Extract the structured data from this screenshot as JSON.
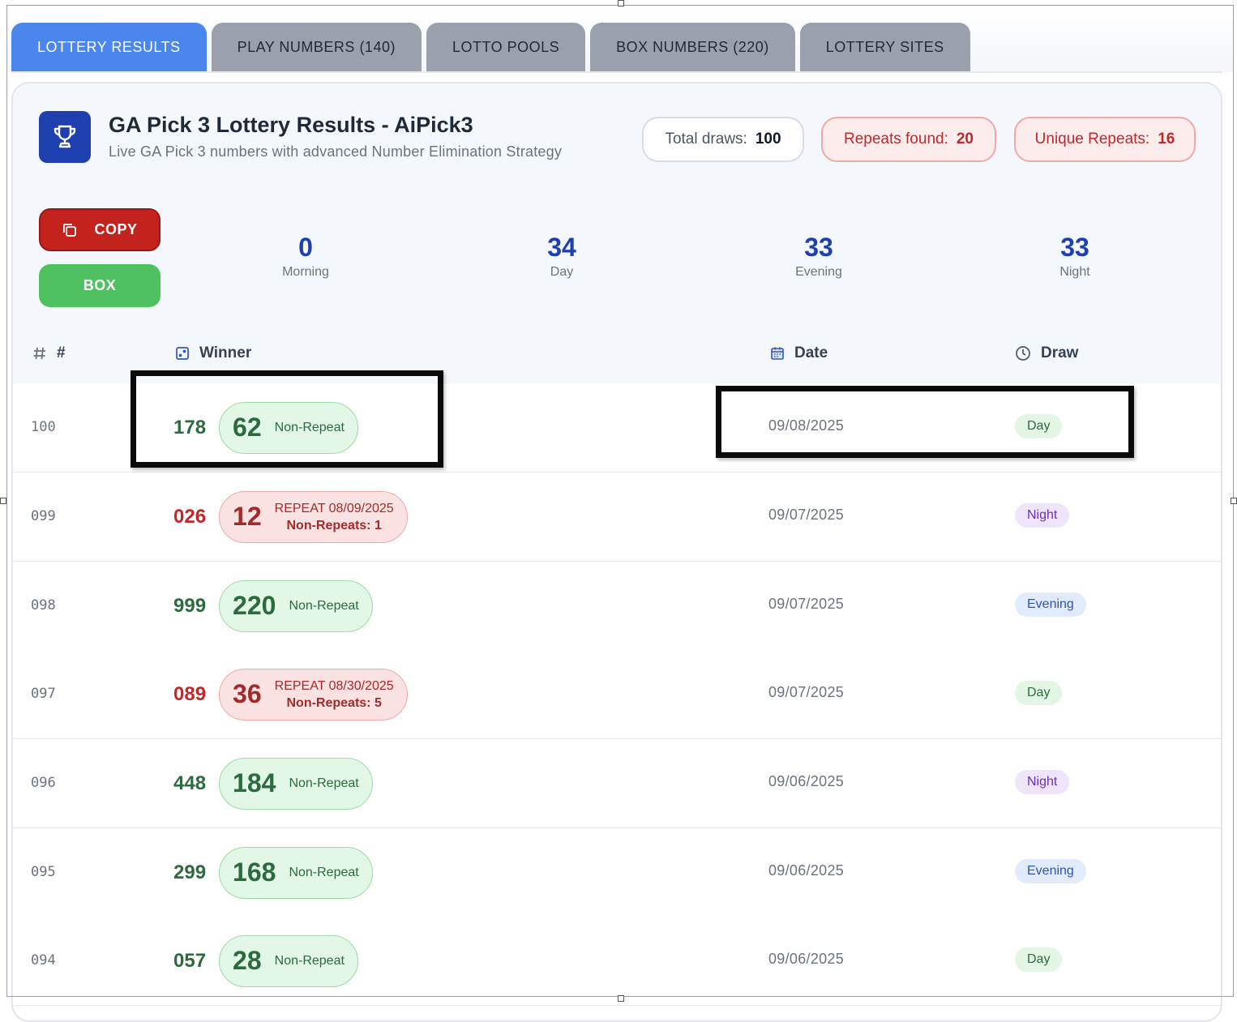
{
  "tabs": [
    {
      "label": "LOTTERY RESULTS",
      "active": true
    },
    {
      "label": "PLAY NUMBERS (140)",
      "active": false
    },
    {
      "label": "LOTTO POOLS",
      "active": false
    },
    {
      "label": "BOX NUMBERS (220)",
      "active": false
    },
    {
      "label": "LOTTERY SITES",
      "active": false
    }
  ],
  "header": {
    "icon": "trophy-icon",
    "title": "GA Pick 3 Lottery Results - AiPick3",
    "subtitle": "Live GA Pick 3 numbers with advanced Number Elimination Strategy",
    "total_label": "Total draws:",
    "total_value": "100",
    "repeats_label": "Repeats found:",
    "repeats_value": "20",
    "unique_label": "Unique Repeats:",
    "unique_value": "16"
  },
  "actions": {
    "copy_label": "COPY",
    "copy_icon": "copy-icon",
    "box_label": "BOX"
  },
  "stats": [
    {
      "value": "0",
      "label": "Morning"
    },
    {
      "value": "34",
      "label": "Day"
    },
    {
      "value": "33",
      "label": "Evening"
    },
    {
      "value": "33",
      "label": "Night"
    }
  ],
  "table": {
    "headers": {
      "num": "#",
      "num_icon": "hash-icon",
      "winner": "Winner",
      "winner_icon": "dice-icon",
      "date": "Date",
      "date_icon": "calendar-icon",
      "draw": "Draw",
      "draw_icon": "clock-icon"
    },
    "rows": [
      {
        "num": "100",
        "winner": "178",
        "status": "green",
        "box": "62",
        "tag": "Non-Repeat",
        "tag2": "",
        "date": "09/08/2025",
        "draw": "Day"
      },
      {
        "num": "099",
        "winner": "026",
        "status": "red",
        "box": "12",
        "tag": "REPEAT 08/09/2025",
        "tag2": "Non-Repeats: 1",
        "date": "09/07/2025",
        "draw": "Night"
      },
      {
        "num": "098",
        "winner": "999",
        "status": "green",
        "box": "220",
        "tag": "Non-Repeat",
        "tag2": "",
        "date": "09/07/2025",
        "draw": "Evening"
      },
      {
        "num": "097",
        "winner": "089",
        "status": "red",
        "box": "36",
        "tag": "REPEAT 08/30/2025",
        "tag2": "Non-Repeats: 5",
        "date": "09/07/2025",
        "draw": "Day"
      },
      {
        "num": "096",
        "winner": "448",
        "status": "green",
        "box": "184",
        "tag": "Non-Repeat",
        "tag2": "",
        "date": "09/06/2025",
        "draw": "Night"
      },
      {
        "num": "095",
        "winner": "299",
        "status": "green",
        "box": "168",
        "tag": "Non-Repeat",
        "tag2": "",
        "date": "09/06/2025",
        "draw": "Evening"
      },
      {
        "num": "094",
        "winner": "057",
        "status": "green",
        "box": "28",
        "tag": "Non-Repeat",
        "tag2": "",
        "date": "09/06/2025",
        "draw": "Day"
      }
    ]
  },
  "colors": {
    "tab_active": "#4b86ec",
    "tab_inactive": "#9aa1ad",
    "brand_blue": "#1e3fae",
    "copy_red": "#c3231c",
    "box_green": "#4fc160",
    "repeat_red": "#c0282b",
    "nonrepeat_green": "#2d6a3e"
  }
}
